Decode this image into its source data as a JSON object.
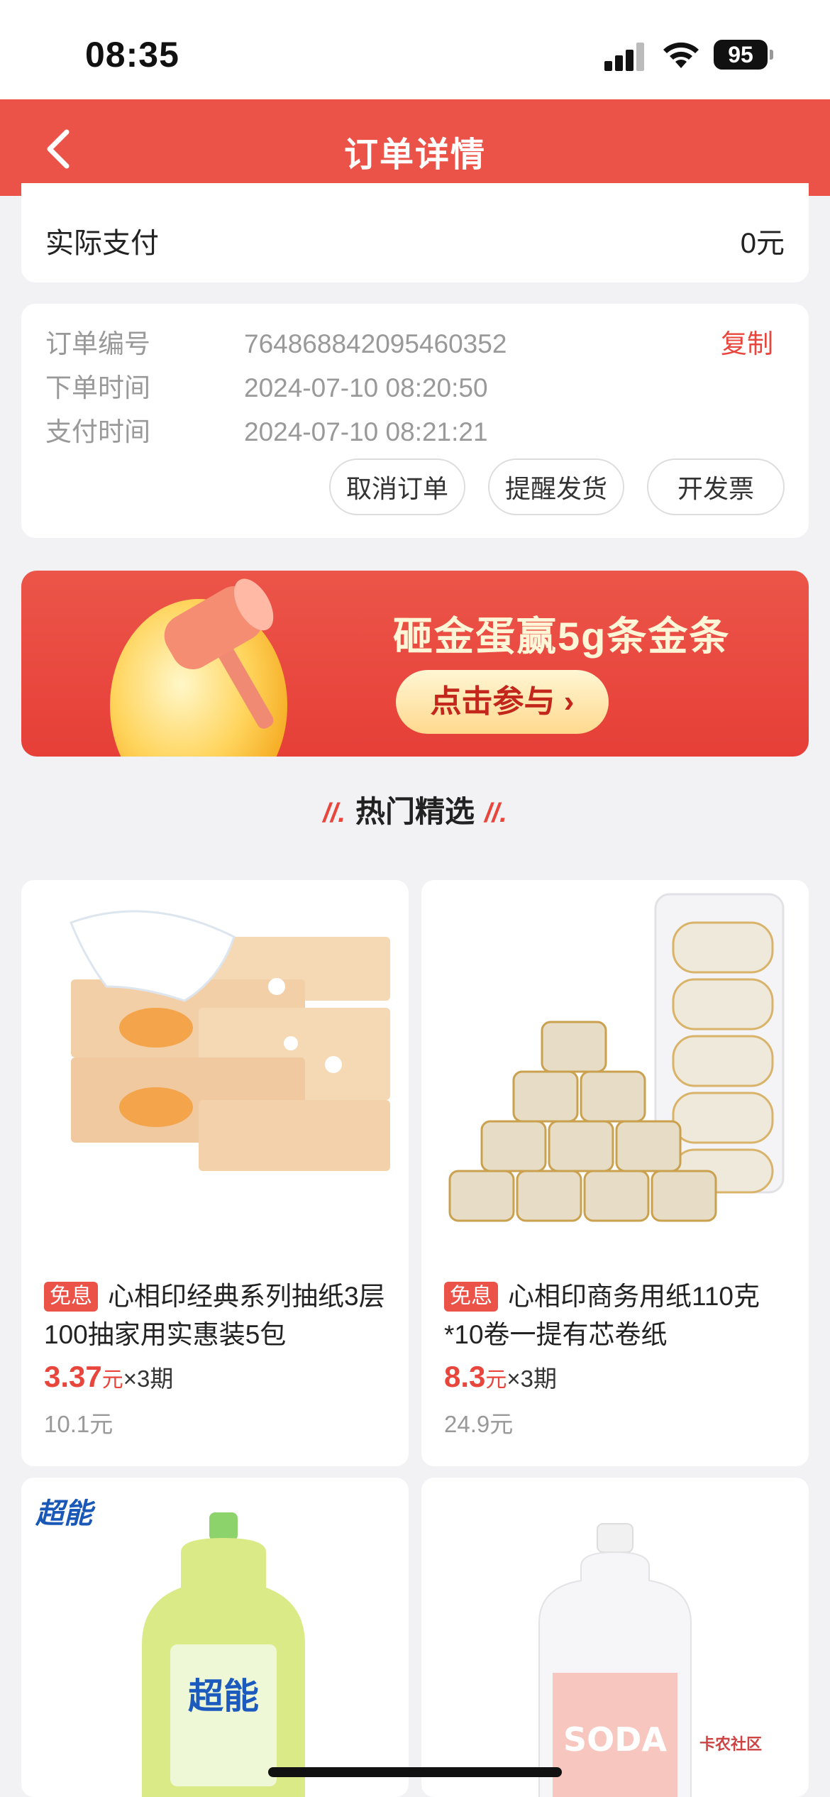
{
  "status_bar": {
    "time": "08:35",
    "battery": "95"
  },
  "header": {
    "title": "订单详情"
  },
  "payment": {
    "label": "实际支付",
    "value": "0元"
  },
  "order_info": {
    "rows": [
      {
        "key": "订单编号",
        "value": "764868842095460352"
      },
      {
        "key": "下单时间",
        "value": "2024-07-10 08:20:50"
      },
      {
        "key": "支付时间",
        "value": "2024-07-10 08:21:21"
      }
    ],
    "copy_label": "复制",
    "buttons": {
      "cancel": "取消订单",
      "remind": "提醒发货",
      "invoice": "开发票"
    }
  },
  "banner": {
    "text": "砸金蛋赢5g条金条",
    "cta": "点击参与 ›"
  },
  "section": {
    "title": "热门精选",
    "slash": "//."
  },
  "products": [
    {
      "tag": "免息",
      "title": "心相印经典系列抽纸3层100抽家用实惠装5包",
      "price": "3.37",
      "unit": "元",
      "installment": "×3期",
      "original": "10.1元"
    },
    {
      "tag": "免息",
      "title": "心相印商务用纸110克*10卷一提有芯卷纸",
      "price": "8.3",
      "unit": "元",
      "installment": "×3期",
      "original": "24.9元"
    },
    {
      "brand": "超能",
      "title": ""
    },
    {
      "brand": "SODA",
      "title": ""
    }
  ],
  "watermark": {
    "name": "卡农社区"
  },
  "colors": {
    "accent": "#eb5248",
    "price": "#e8463c"
  }
}
